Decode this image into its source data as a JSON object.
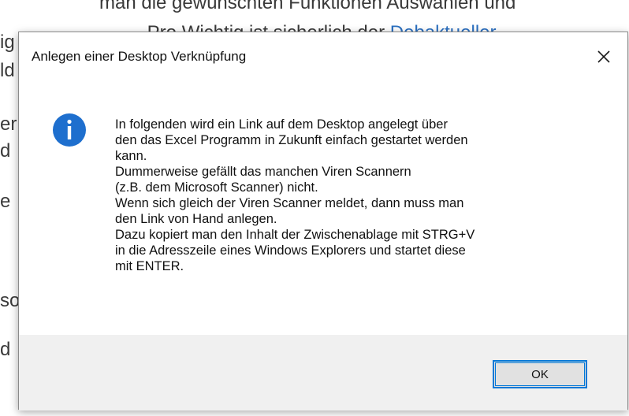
{
  "background": {
    "top_line": "man die gewünschten Funktionen Auswählen und",
    "link_line_prefix": "... Pro Wichtig ist sicherlich der ",
    "link_text": "Debaktueller",
    "link_line_suffix": "...",
    "left_fragments": [
      "ig",
      "ld",
      "er",
      "d",
      "e",
      "so",
      "d"
    ]
  },
  "dialog": {
    "title": "Anlegen einer Desktop Verknüpfung",
    "close_glyph": "✕",
    "message_lines": [
      "In folgenden wird ein Link auf dem Desktop angelegt über",
      "den das Excel Programm in Zukunft einfach gestartet werden",
      "kann.",
      "Dummerweise gefällt das manchen Viren Scannern",
      "(z.B. dem Microsoft Scanner) nicht.",
      "Wenn sich gleich der Viren Scanner meldet, dann muss man",
      "den Link von Hand anlegen.",
      "Dazu kopiert man den Inhalt der Zwischenablage mit STRG+V",
      "in die Adresszeile eines Windows Explorers und startet diese",
      "mit ENTER."
    ],
    "ok_label": "OK",
    "info_icon_color": "#1e6fce"
  }
}
